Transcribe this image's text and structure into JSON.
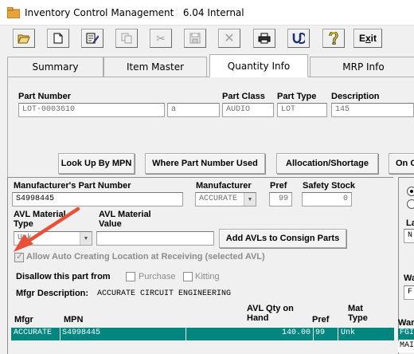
{
  "window": {
    "title": "Inventory Control Management",
    "version": "6.04 Internal"
  },
  "toolbar": {
    "exit_label": "Exit",
    "exit_underline": "x"
  },
  "tabs": [
    {
      "label": "Summary"
    },
    {
      "label": "Item Master"
    },
    {
      "label": "Quantity Info"
    },
    {
      "label": "MRP Info"
    }
  ],
  "header": {
    "part_number_label": "Part Number",
    "part_number": "LOT-0003610",
    "revision": "a",
    "part_class_label": "Part Class",
    "part_class": "AUDIO",
    "part_type_label": "Part Type",
    "part_type": "LOT",
    "description_label": "Description",
    "description": "145"
  },
  "actions": {
    "lookup_mpn": "Look Up By MPN",
    "where_used": "Where Part Number Used",
    "allocation": "Allocation/Shortage",
    "on_order": "On O"
  },
  "mpn_section": {
    "mpn_label": "Manufacturer's Part Number",
    "mpn": "S4998445",
    "manufacturer_label": "Manufacturer",
    "manufacturer": "ACCURATE",
    "pref_label": "Pref",
    "pref": "99",
    "safety_stock_label": "Safety Stock",
    "safety_stock": "0",
    "avl_type_label_1": "AVL Material",
    "avl_type_label_2": "Type",
    "avl_type": "Unk",
    "avl_value_label_1": "AVL Material",
    "avl_value_label_2": "Value",
    "avl_value": "",
    "add_avls_button": "Add AVLs to Consign Parts",
    "auto_create_label": "Allow Auto Creating Location at Receiving (selected AVL)",
    "disallow_label": "Disallow this part from",
    "purchase_label": "Purchase",
    "kitting_label": "Kitting",
    "mfgr_desc_label": "Mfgr Description:",
    "mfgr_desc": "ACCURATE CIRCUIT ENGINEERING"
  },
  "avl_table": {
    "headers": {
      "mfgr": "Mfgr",
      "mpn": "MPN",
      "avl_qty_1": "AVL Qty on",
      "avl_qty_2": "Hand",
      "pref": "Pref",
      "mat_type_1": "Mat",
      "mat_type_2": "Type"
    },
    "rows": [
      {
        "mfgr": "ACCURATE",
        "mpn": "S4998445",
        "qty": "140.00",
        "pref": "99",
        "type": "Unk"
      }
    ]
  },
  "right_panel": {
    "label_la": "La",
    "field_n": "N",
    "label_wa": "Wa",
    "field_f": "F",
    "label_ware": "Ware",
    "row1": "FGI",
    "row2": "MAI"
  },
  "colors": {
    "arrow": "#e8503a",
    "row_highlight": "#00857f"
  }
}
